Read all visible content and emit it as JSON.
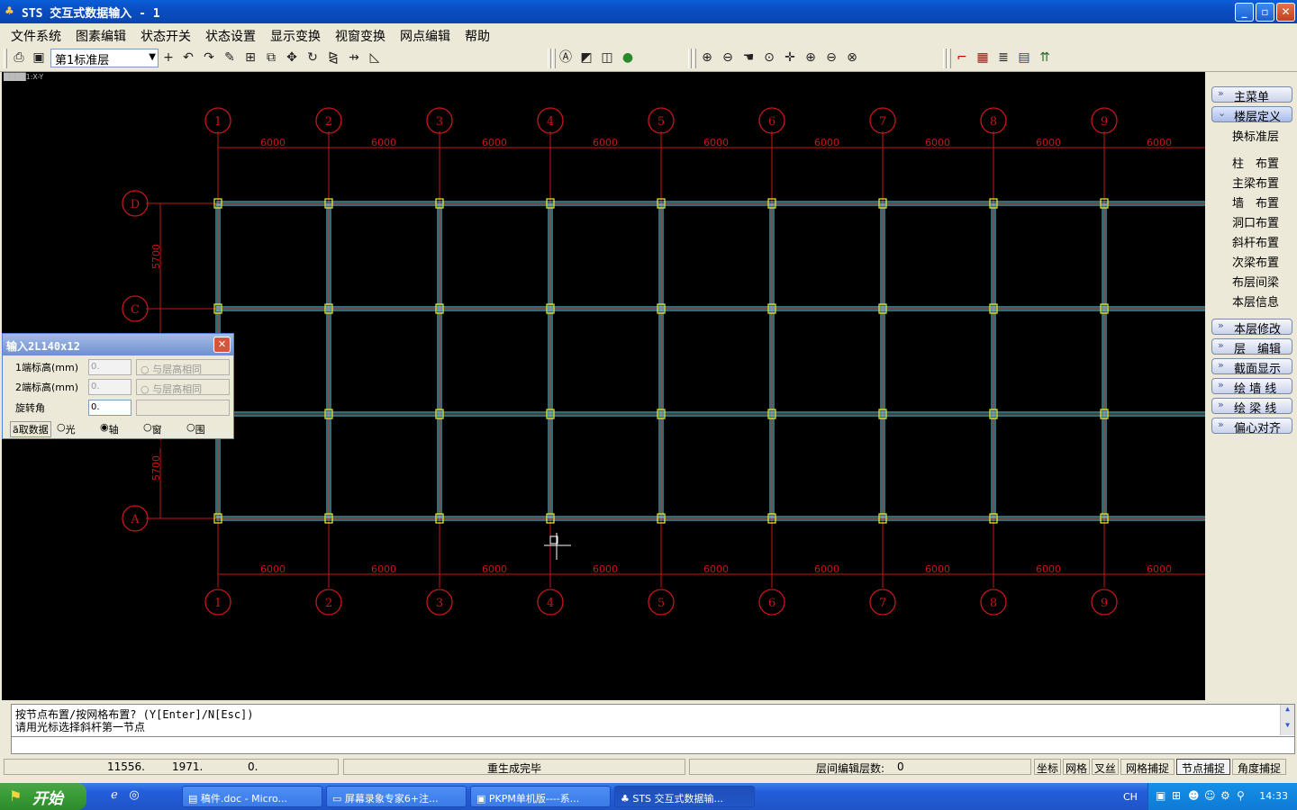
{
  "window": {
    "title": "STS 交互式数据输入 - 1",
    "minimize": "_",
    "maximize": "▫",
    "close": "✕"
  },
  "menu": [
    "文件系统",
    "图素编辑",
    "状态开关",
    "状态设置",
    "显示变换",
    "视窗变换",
    "网点编辑",
    "帮助"
  ],
  "toolbar": {
    "layer_select": "第1标准层"
  },
  "canvas": {
    "view_indicator": "████1:X-Y",
    "axes_top": [
      "1",
      "2",
      "3",
      "4",
      "5",
      "6",
      "7",
      "8",
      "9"
    ],
    "axes_bottom": [
      "1",
      "2",
      "3",
      "4",
      "5",
      "6",
      "7",
      "8",
      "9"
    ],
    "axes_left": [
      "D",
      "C",
      "A"
    ],
    "spans_top": [
      "6000",
      "6000",
      "6000",
      "6000",
      "6000",
      "6000",
      "6000",
      "6000",
      "6000"
    ],
    "spans_bottom": [
      "6000",
      "6000",
      "6000",
      "6000",
      "6000",
      "6000",
      "6000",
      "6000",
      "6000"
    ],
    "spans_left": [
      "5700",
      "5700"
    ]
  },
  "dialog": {
    "title": "输入2L140x12",
    "close": "✕",
    "row1_label": "1端标高(mm)",
    "row1_value": "0.",
    "row1_option": "与层高相同",
    "row2_label": "2端标高(mm)",
    "row2_value": "0.",
    "row2_option": "与层高相同",
    "row3_label": "旋转角",
    "row3_value": "0.",
    "radio_prefix": "ã取数据",
    "radio_options": [
      "光标:",
      "轴线:",
      "窗口:",
      "围栏:"
    ],
    "radio_selected": "轴线:"
  },
  "rightpanel": {
    "main_menu": "主菜单",
    "floor_def": "楼层定义",
    "sub_items": [
      "换标准层",
      "柱　布置",
      "主梁布置",
      "墙　布置",
      "洞口布置",
      "斜杆布置",
      "次梁布置",
      "布层间梁",
      "本层信息"
    ],
    "bottom_items": [
      "本层修改",
      "层　编辑",
      "截面显示",
      "绘 墙 线",
      "绘 梁 线",
      "偏心对齐"
    ]
  },
  "command": {
    "line1": "按节点布置/按网格布置? (Y[Enter]/N[Esc])",
    "line2": "请用光标选择斜杆第一节点",
    "input": ""
  },
  "status": {
    "x": "11556.",
    "y": "1971.",
    "z": "0.",
    "message": "重生成完毕",
    "layer_edit_label": "层间编辑层数:",
    "layer_edit_value": "0",
    "toggles": [
      "坐标",
      "网格",
      "叉丝",
      "网格捕捉",
      "节点捕捉",
      "角度捕捉"
    ],
    "toggles_on": [
      "节点捕捉"
    ]
  },
  "taskbar": {
    "start": "开始",
    "tasks": [
      "稿件.doc - Micro...",
      "屏幕录象专家6+注...",
      "PKPM单机版----系...",
      "STS 交互式数据输..."
    ],
    "active_task": "STS 交互式数据输...",
    "ime": "CH",
    "clock": "14:33"
  }
}
